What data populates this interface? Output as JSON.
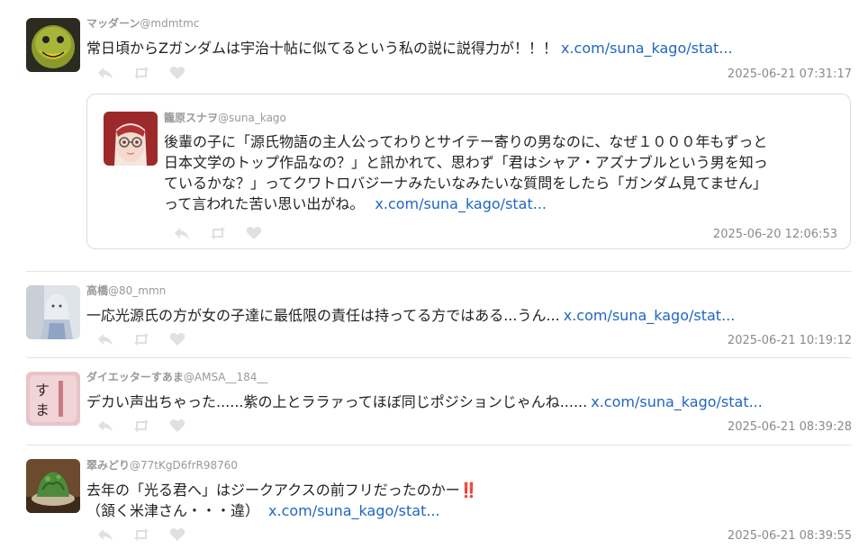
{
  "tweets": [
    {
      "display_name": "マッダーン",
      "handle": "@mdmtmc",
      "text": "常日頃からZガンダムは宇治十帖に似てるという私の説に説得力が！！！",
      "link": "x.com/suna_kago/stat...",
      "timestamp": "2025-06-21 07:31:17",
      "avatar_icon": "green-cartoon-face-avatar"
    },
    {
      "display_name": "高橋",
      "handle": "@80_mmn",
      "text": "一応光源氏の方が女の子達に最低限の責任は持ってる方ではある...うん...",
      "link": "x.com/suna_kago/stat...",
      "timestamp": "2025-06-21 10:19:12",
      "avatar_icon": "figure-photo-avatar"
    },
    {
      "display_name": "ダイエッターすあま",
      "handle": "@AMSA__184__",
      "text": "デカい声出ちゃった......紫の上とララァってほぼ同じポジションじゃんね......",
      "link": "x.com/suna_kago/stat...",
      "timestamp": "2025-06-21 08:39:28",
      "avatar_icon": "suama-sweet-avatar"
    },
    {
      "display_name": "翠みどり",
      "handle": "@77tKgD6frR98760",
      "text_line1": "去年の「光る君へ」はジークアクスの前フリだったのかー‼️",
      "text_line2": "（頷く米津さん・・・違）",
      "link": "x.com/suna_kago/stat...",
      "timestamp": "2025-06-21 08:39:55",
      "avatar_icon": "green-dessert-avatar"
    }
  ],
  "quoted": {
    "display_name": "籠原スナヲ",
    "handle": "@suna_kago",
    "lines": [
      "後輩の子に「源氏物語の主人公ってわりとサイテー寄りの男なのに、なぜ１０００年もずっと",
      "日本文学のトップ作品なの？」と訊かれて、思わず「君はシャア・アズナブルという男を知っ",
      "ているかな？」ってクワトロバジーナみたいなみたいな質問をしたら「ガンダム見てません」",
      "って言われた苦い思い出がね。"
    ],
    "link": "x.com/suna_kago/stat...",
    "timestamp": "2025-06-20 12:06:53",
    "avatar_icon": "red-hair-glasses-anime-avatar"
  },
  "icons": {
    "reply": "reply-icon",
    "retweet": "retweet-icon",
    "like": "heart-icon"
  },
  "colors": {
    "link": "#1f66c1",
    "meta": "#8a8a8a",
    "icon": "#e0e0e0"
  }
}
